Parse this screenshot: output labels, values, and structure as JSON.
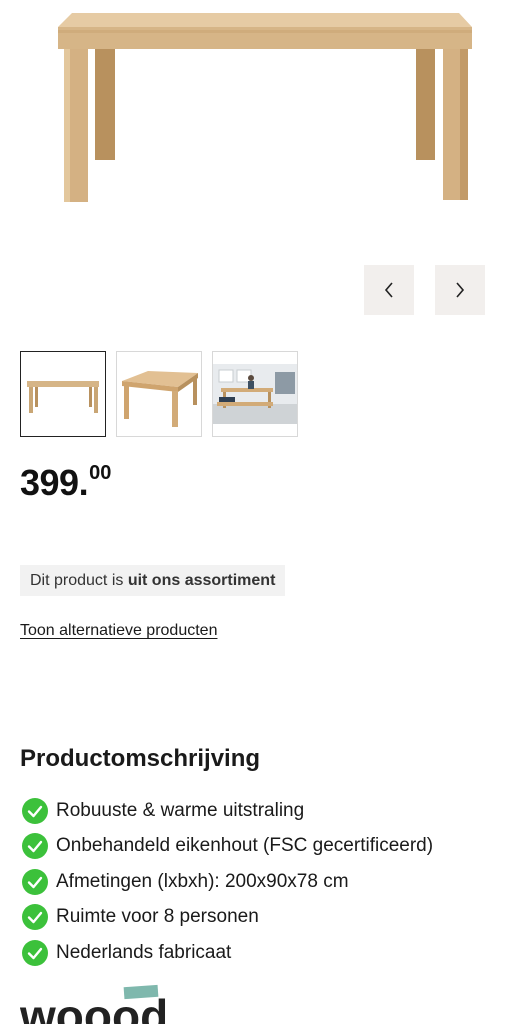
{
  "gallery": {
    "main_image": "oak-dining-table-photo",
    "prev_icon": "chevron-left-icon",
    "next_icon": "chevron-right-icon",
    "thumbnails": [
      "table-front-view",
      "table-angle-view",
      "table-room-scene"
    ]
  },
  "price": {
    "integer": "399.",
    "decimals": "00"
  },
  "availability": {
    "prefix": "Dit product is ",
    "bold": "uit ons assortiment"
  },
  "alternatives_link": "Toon alternatieve producten",
  "description": {
    "title": "Productomschrijving",
    "features": [
      "Robuuste & warme uitstraling",
      "Onbehandeld eikenhout (FSC gecertificeerd)",
      "Afmetingen (lxbxh): 200x90x78 cm",
      "Ruimte voor 8 personen",
      "Nederlands fabricaat"
    ],
    "check_color": "#3cc13b"
  },
  "brand": {
    "logo": "woood-logo"
  },
  "colors": {
    "wood": "#d9b98e",
    "wood_dark": "#b48c5c",
    "nav_bg": "#f2efed",
    "badge_bg": "#f2f2f2"
  }
}
